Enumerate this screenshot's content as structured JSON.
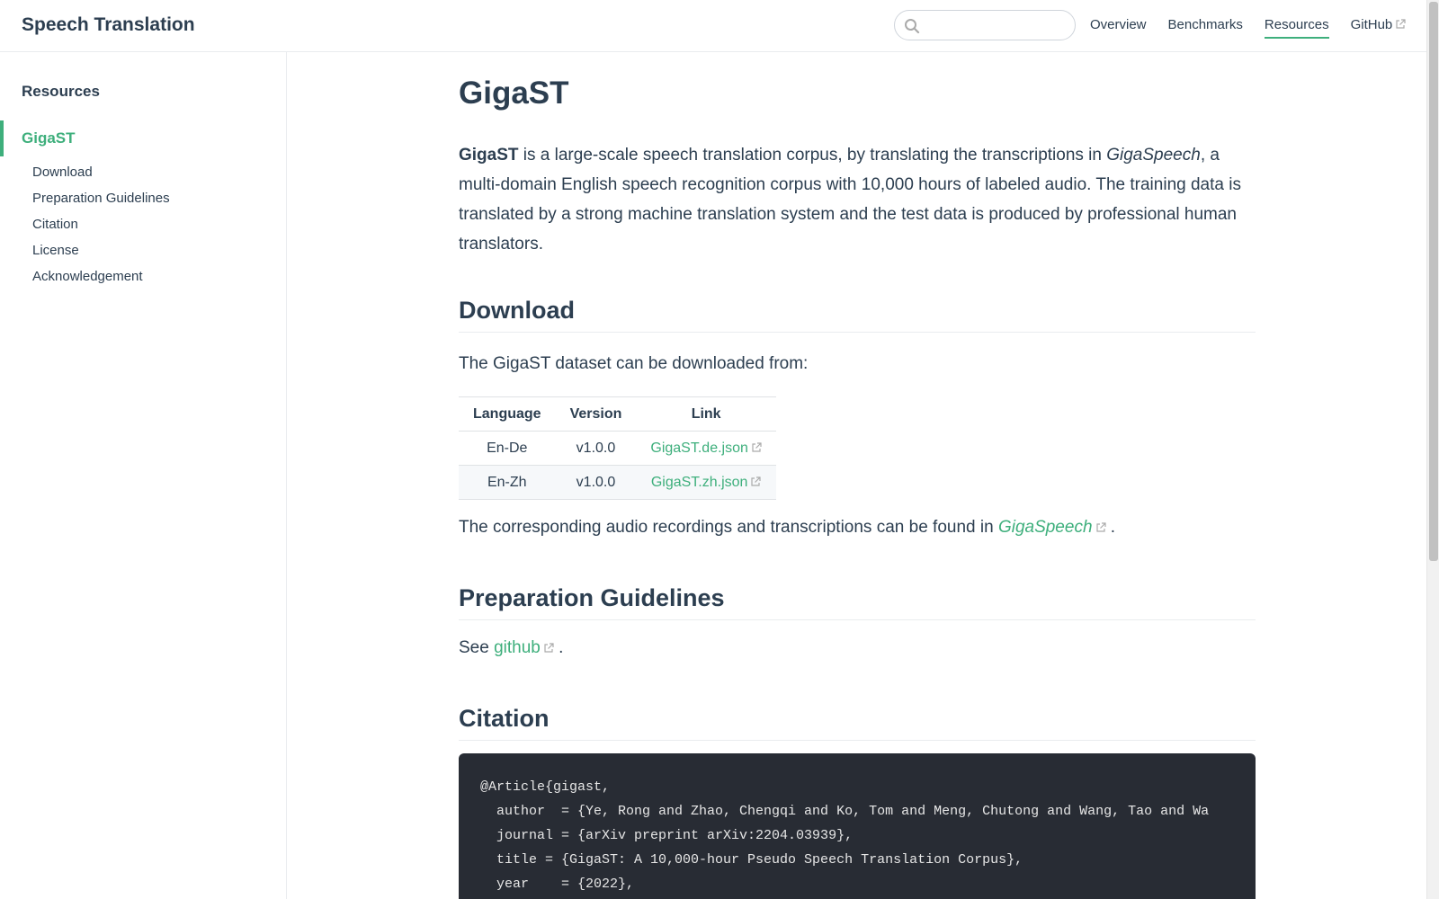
{
  "header": {
    "site_name": "Speech Translation",
    "search": {
      "value": "",
      "placeholder": ""
    },
    "nav": [
      {
        "label": "Overview",
        "active": false,
        "external": false
      },
      {
        "label": "Benchmarks",
        "active": false,
        "external": false
      },
      {
        "label": "Resources",
        "active": true,
        "external": false
      },
      {
        "label": "GitHub",
        "active": false,
        "external": true
      }
    ]
  },
  "sidebar": {
    "heading": "Resources",
    "active_item": "GigaST",
    "sub_items": [
      "Download",
      "Preparation Guidelines",
      "Citation",
      "License",
      "Acknowledgement"
    ]
  },
  "content": {
    "title": "GigaST",
    "intro": {
      "bold": "GigaST",
      "text1": " is a large-scale speech translation corpus, by translating the transcriptions in ",
      "italic": "GigaSpeech",
      "text2": ", a multi-domain English speech recognition corpus with 10,000 hours of labeled audio. The training data is translated by a strong machine translation system and the test data is produced by professional human translators."
    },
    "download": {
      "heading": "Download",
      "lead": "The GigaST dataset can be downloaded from:",
      "table": {
        "headers": [
          "Language",
          "Version",
          "Link"
        ],
        "rows": [
          {
            "language": "En-De",
            "version": "v1.0.0",
            "link": "GigaST.de.json"
          },
          {
            "language": "En-Zh",
            "version": "v1.0.0",
            "link": "GigaST.zh.json"
          }
        ]
      },
      "after_prefix": "The corresponding audio recordings and transcriptions can be found in ",
      "after_link": "GigaSpeech",
      "after_suffix": " ."
    },
    "prep": {
      "heading": "Preparation Guidelines",
      "prefix": "See ",
      "link": "github",
      "suffix": " ."
    },
    "citation": {
      "heading": "Citation",
      "lines": [
        "@Article{gigast,",
        "  author  = {Ye, Rong and Zhao, Chengqi and Ko, Tom and Meng, Chutong and Wang, Tao and Wa",
        "  journal = {arXiv preprint arXiv:2204.03939},",
        "  title = {GigaST: A 10,000-hour Pseudo Speech Translation Corpus},",
        "  year    = {2022},"
      ]
    }
  },
  "colors": {
    "accent": "#3eaf7c",
    "text": "#2c3e50",
    "code_bg": "#282c34"
  }
}
